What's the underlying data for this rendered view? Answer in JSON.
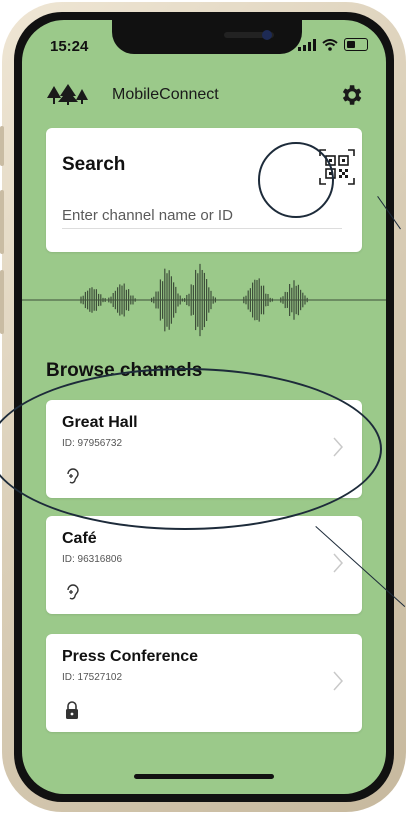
{
  "status_bar": {
    "time": "15:24"
  },
  "header": {
    "title": "MobileConnect",
    "logo_icon": "trees-icon",
    "settings_icon": "gear-icon"
  },
  "search": {
    "title": "Search",
    "placeholder": "Enter channel name or ID",
    "qr_icon": "qr-code-icon"
  },
  "browse": {
    "title": "Browse channels",
    "channels": [
      {
        "name": "Great Hall",
        "id": "ID: 97956732",
        "icon": "hearing-icon"
      },
      {
        "name": "Café",
        "id": "ID: 96316806",
        "icon": "hearing-icon"
      },
      {
        "name": "Press Conference",
        "id": "ID: 17527102",
        "icon": "lock-icon"
      }
    ]
  },
  "colors": {
    "background": "#9bc98a",
    "card": "#ffffff",
    "annotation": "#1d2b3a"
  }
}
